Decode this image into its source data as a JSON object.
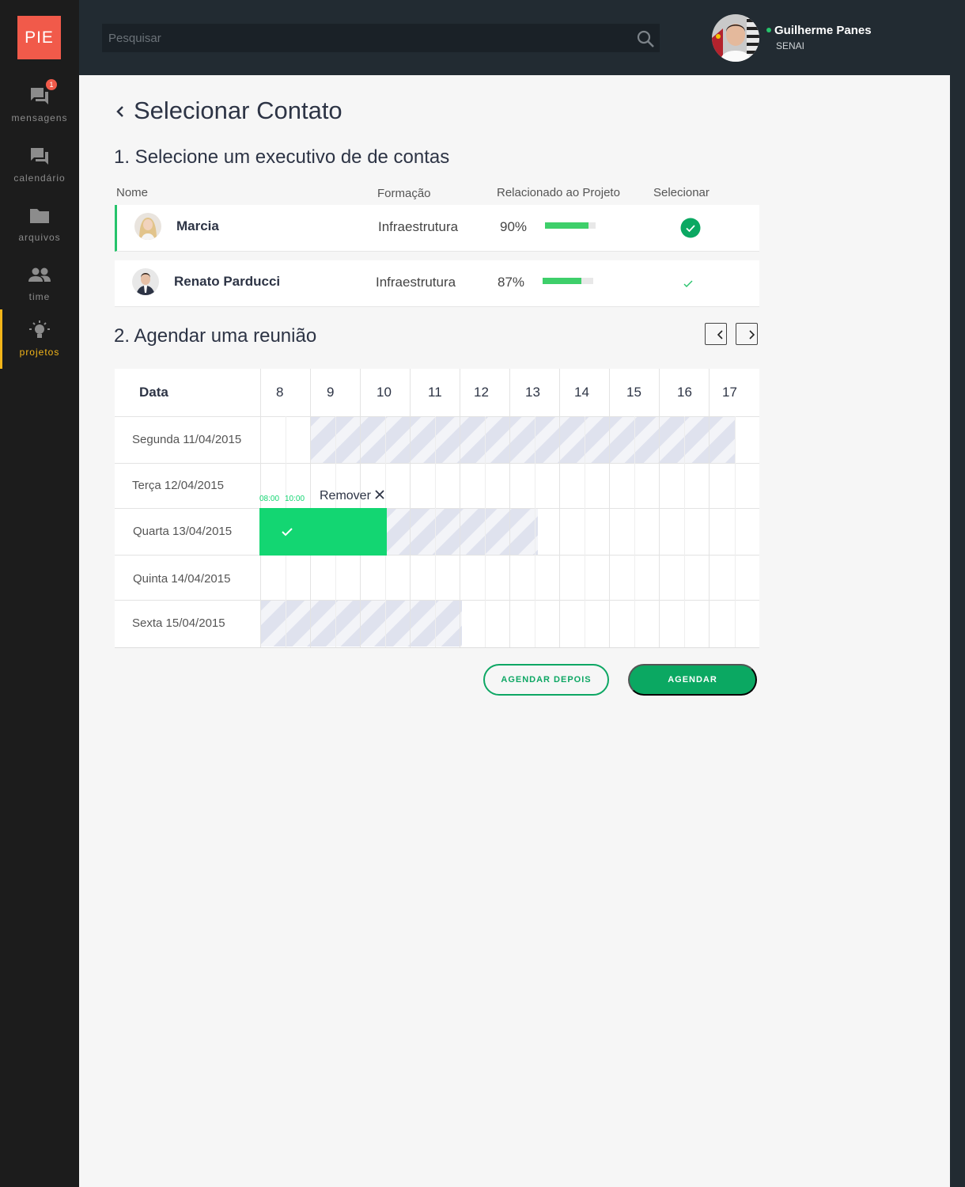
{
  "app": {
    "logo": "PIE"
  },
  "sidebar": {
    "items": [
      {
        "label": "mensagens",
        "icon": "chat-icon",
        "badge": "1"
      },
      {
        "label": "calendário",
        "icon": "chat-icon"
      },
      {
        "label": "arquivos",
        "icon": "folder-icon"
      },
      {
        "label": "time",
        "icon": "people-icon"
      },
      {
        "label": "projetos",
        "icon": "lightbulb-icon",
        "active": true
      }
    ]
  },
  "header": {
    "search_placeholder": "Pesquisar",
    "user": {
      "name": "Guilherme Panes",
      "org": "SENAI",
      "status": "online"
    }
  },
  "page": {
    "title": "Selecionar Contato",
    "step1": "1. Selecione um executivo de  de contas",
    "columns": {
      "name": "Nome",
      "training": "Formação",
      "related": "Relacionado ao Projeto",
      "select": "Selecionar"
    },
    "contacts": [
      {
        "name": "Marcia",
        "training": "Infraestrutura",
        "percent": "90%",
        "fill": 0.86,
        "selected": true
      },
      {
        "name": "Renato Parducci",
        "training": "Infraestrutura",
        "percent": "87%",
        "fill": 0.77,
        "selected": false
      }
    ],
    "step2": "2. Agendar uma reunião",
    "schedule": {
      "date_header": "Data",
      "hours": [
        "8",
        "9",
        "10",
        "11",
        "12",
        "13",
        "14",
        "15",
        "16",
        "17"
      ],
      "days": [
        "Segunda 11/04/2015",
        "Terça 12/04/2015",
        "Quarta 13/04/2015",
        "Quinta 14/04/2015",
        "Sexta 15/04/2015"
      ],
      "booking": {
        "start": "08:00",
        "end": "10:00",
        "remove_label": "Remover"
      }
    },
    "buttons": {
      "later": "AGENDAR DEPOIS",
      "schedule": "AGENDAR"
    }
  },
  "colors": {
    "accent": "#0ba862",
    "booked": "#13d672",
    "active_nav": "#f3b519",
    "logo": "#f15a4a"
  }
}
